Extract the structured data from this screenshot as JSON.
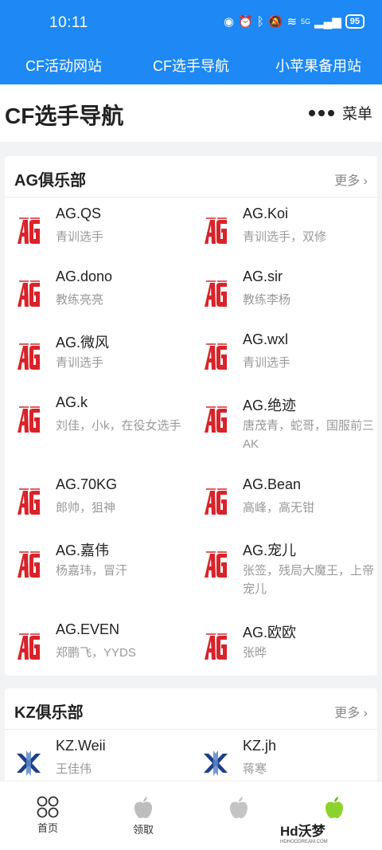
{
  "status": {
    "time": "10:11",
    "signal": "5G",
    "battery": "95"
  },
  "top_nav": [
    "CF活动网站",
    "CF选手导航",
    "小苹果备用站"
  ],
  "header": {
    "title": "CF选手导航",
    "menu_label": "菜单"
  },
  "sections": [
    {
      "title": "AG俱乐部",
      "more": "更多",
      "players": [
        {
          "name": "AG.QS",
          "desc": "青训选手"
        },
        {
          "name": "AG.Koi",
          "desc": "青训选手，双修"
        },
        {
          "name": "AG.dono",
          "desc": "教练亮亮"
        },
        {
          "name": "AG.sir",
          "desc": "教练李杨"
        },
        {
          "name": "AG.微风",
          "desc": "青训选手"
        },
        {
          "name": "AG.wxl",
          "desc": "青训选手"
        },
        {
          "name": "AG.k",
          "desc": "刘佳，小k，在役女选手"
        },
        {
          "name": "AG.绝迹",
          "desc": "唐茂青，蛇哥，国服前三AK"
        },
        {
          "name": "AG.70KG",
          "desc": "郎帅，狙神"
        },
        {
          "name": "AG.Bean",
          "desc": "高峰，高无钳"
        },
        {
          "name": "AG.嘉伟",
          "desc": "杨嘉玮，冒汗"
        },
        {
          "name": "AG.宠儿",
          "desc": "张签，残局大魔王，上帝宠儿"
        },
        {
          "name": "AG.EVEN",
          "desc": "郑鹏飞，YYDS"
        },
        {
          "name": "AG.欧欧",
          "desc": "张晔"
        }
      ]
    },
    {
      "title": "KZ俱乐部",
      "more": "更多",
      "players": [
        {
          "name": "KZ.Weii",
          "desc": "王佳伟"
        },
        {
          "name": "KZ.jh",
          "desc": "蒋寒"
        }
      ]
    }
  ],
  "bottom_nav": [
    {
      "label": "首页",
      "icon": "grid-icon"
    },
    {
      "label": "领取",
      "icon": "apple-icon"
    },
    {
      "label": "",
      "icon": "apple-icon"
    },
    {
      "label": "",
      "icon": "apple-green-icon"
    }
  ],
  "watermark": {
    "text": "Hd沃梦",
    "sub": "HDHOODREAM.COM"
  },
  "colors": {
    "primary": "#1e88f5",
    "ag_red": "#d9232a",
    "kz_blue": "#1d3e8a",
    "apple_green": "#8bd32c"
  }
}
